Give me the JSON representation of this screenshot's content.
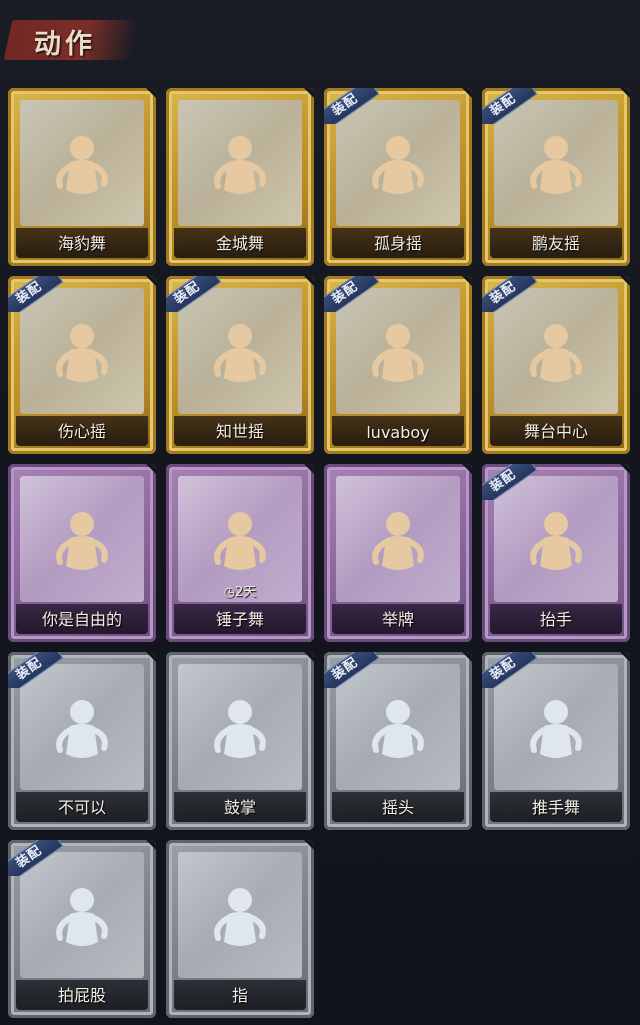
{
  "header": {
    "title": "动作"
  },
  "equip_label": "装配",
  "rarity_colors": {
    "gold": "#c59b30",
    "purple": "#8e6a9f",
    "gray": "#7f868d"
  },
  "cards": [
    {
      "label": "海豹舞",
      "rarity": "gold",
      "equipped": false,
      "icon": "dance-figure-icon"
    },
    {
      "label": "金城舞",
      "rarity": "gold",
      "equipped": false,
      "icon": "dance-figure-icon"
    },
    {
      "label": "孤身摇",
      "rarity": "gold",
      "equipped": true,
      "icon": "dance-figure-icon"
    },
    {
      "label": "鹏友摇",
      "rarity": "gold",
      "equipped": true,
      "icon": "dance-figure-icon"
    },
    {
      "label": "伤心摇",
      "rarity": "gold",
      "equipped": true,
      "icon": "heart-pose-figure-icon"
    },
    {
      "label": "知世摇",
      "rarity": "gold",
      "equipped": true,
      "icon": "dance-figure-icon"
    },
    {
      "label": "luvaboy",
      "rarity": "gold",
      "equipped": true,
      "icon": "dance-figure-icon"
    },
    {
      "label": "舞台中心",
      "rarity": "gold",
      "equipped": true,
      "icon": "dance-figure-icon"
    },
    {
      "label": "你是自由的",
      "rarity": "purple",
      "equipped": false,
      "icon": "two-figures-icon"
    },
    {
      "label": "锤子舞",
      "rarity": "purple",
      "equipped": false,
      "icon": "dance-figure-icon",
      "timer": "2天"
    },
    {
      "label": "举牌",
      "rarity": "purple",
      "equipped": false,
      "icon": "sign-holding-figure-icon"
    },
    {
      "label": "抬手",
      "rarity": "purple",
      "equipped": true,
      "icon": "raise-hand-figure-icon"
    },
    {
      "label": "不可以",
      "rarity": "gray",
      "equipped": true,
      "icon": "finger-wag-icon"
    },
    {
      "label": "鼓掌",
      "rarity": "gray",
      "equipped": false,
      "icon": "clapping-hands-icon"
    },
    {
      "label": "摇头",
      "rarity": "gray",
      "equipped": true,
      "icon": "shake-head-figure-icon"
    },
    {
      "label": "推手舞",
      "rarity": "gray",
      "equipped": true,
      "icon": "push-hands-figure-icon"
    },
    {
      "label": "拍屁股",
      "rarity": "gray",
      "equipped": true,
      "icon": "pat-figure-icon"
    },
    {
      "label": "指",
      "rarity": "gray",
      "equipped": false,
      "icon": "pointing-hand-icon"
    }
  ]
}
